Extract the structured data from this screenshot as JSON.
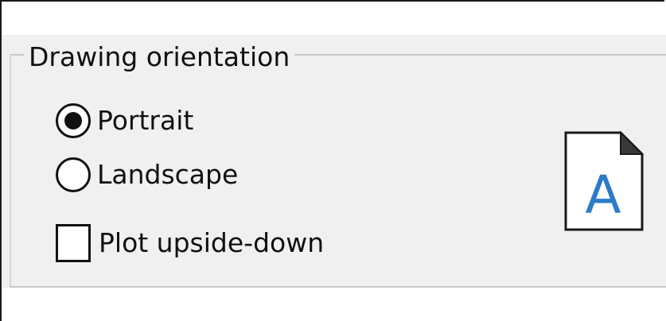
{
  "group": {
    "title": "Drawing orientation"
  },
  "options": {
    "portrait": {
      "label": "Portrait",
      "checked": true
    },
    "landscape": {
      "label": "Landscape",
      "checked": false
    },
    "upside_down": {
      "label": "Plot upside-down",
      "checked": false
    }
  },
  "preview": {
    "letter": "A",
    "icon": "portrait-page-icon",
    "letter_color": "#2b7bc8"
  }
}
